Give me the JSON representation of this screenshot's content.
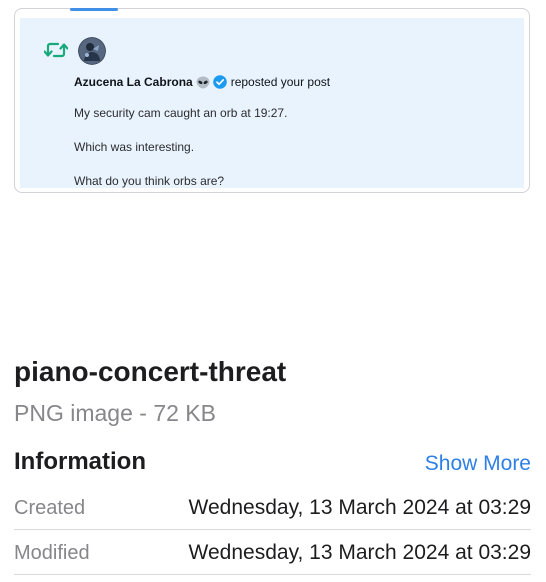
{
  "preview": {
    "notification": {
      "author": "Azucena La Cabrona",
      "action": "reposted your post",
      "post_lines": [
        "My security cam caught an orb at 19:27.",
        "Which was interesting.",
        "What do you think orbs are?"
      ],
      "icons": {
        "repost": "repost-icon",
        "alien": "alien-emoji-icon",
        "verified": "verified-badge-icon"
      },
      "colors": {
        "repost": "#19a97b",
        "verified": "#1d9bf0",
        "background": "#e9f3fd"
      }
    }
  },
  "file": {
    "name": "piano-concert-threat",
    "kind": "PNG image - 72 KB"
  },
  "info": {
    "title": "Information",
    "show_more": "Show More",
    "rows": [
      {
        "label": "Created",
        "value": "Wednesday, 13 March 2024 at 03:29"
      },
      {
        "label": "Modified",
        "value": "Wednesday, 13 March 2024 at 03:29"
      }
    ]
  },
  "colors": {
    "accent": "#2f80e6",
    "secondary_text": "#86868b"
  }
}
